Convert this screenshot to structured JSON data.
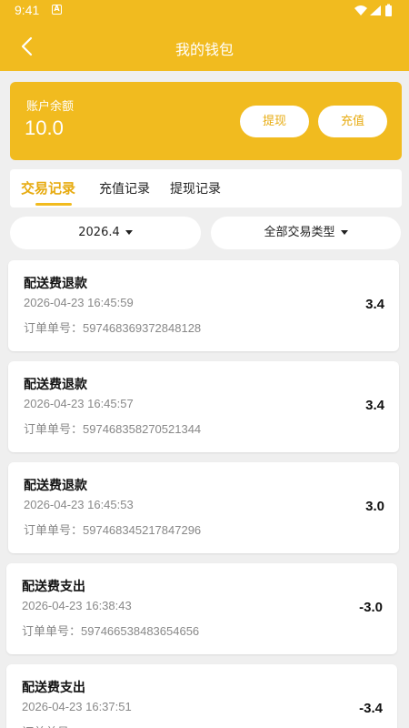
{
  "status": {
    "time": "9:41",
    "notif_glyph": "A"
  },
  "header": {
    "title": "我的钱包"
  },
  "balance": {
    "label": "账户余额",
    "amount": "10.0",
    "withdraw_label": "提现",
    "recharge_label": "充值"
  },
  "tabs": [
    {
      "label": "交易记录",
      "active": true
    },
    {
      "label": "充值记录",
      "active": false
    },
    {
      "label": "提现记录",
      "active": false
    }
  ],
  "filters": {
    "month": "2026.4",
    "type": "全部交易类型"
  },
  "order_prefix": "订单单号：",
  "records": [
    {
      "title": "配送费退款",
      "time": "2026-04-23 16:45:59",
      "order_no": "597468369372848128",
      "amount": "3.4"
    },
    {
      "title": "配送费退款",
      "time": "2026-04-23 16:45:57",
      "order_no": "597468358270521344",
      "amount": "3.4"
    },
    {
      "title": "配送费退款",
      "time": "2026-04-23 16:45:53",
      "order_no": "597468345217847296",
      "amount": "3.0"
    },
    {
      "title": "配送费支出",
      "time": "2026-04-23 16:38:43",
      "order_no": "597466538483654656",
      "amount": "-3.0"
    },
    {
      "title": "配送费支出",
      "time": "2026-04-23 16:37:51",
      "order_no": "",
      "amount": "-3.4"
    }
  ],
  "colors": {
    "accent": "#f1bb1f",
    "accent_text": "#e7ab10",
    "background": "#efefef"
  },
  "icons": {
    "back": "chevron-left-icon",
    "caret": "caret-down-icon",
    "wifi": "wifi-icon",
    "signal": "signal-icon",
    "battery": "battery-icon"
  }
}
